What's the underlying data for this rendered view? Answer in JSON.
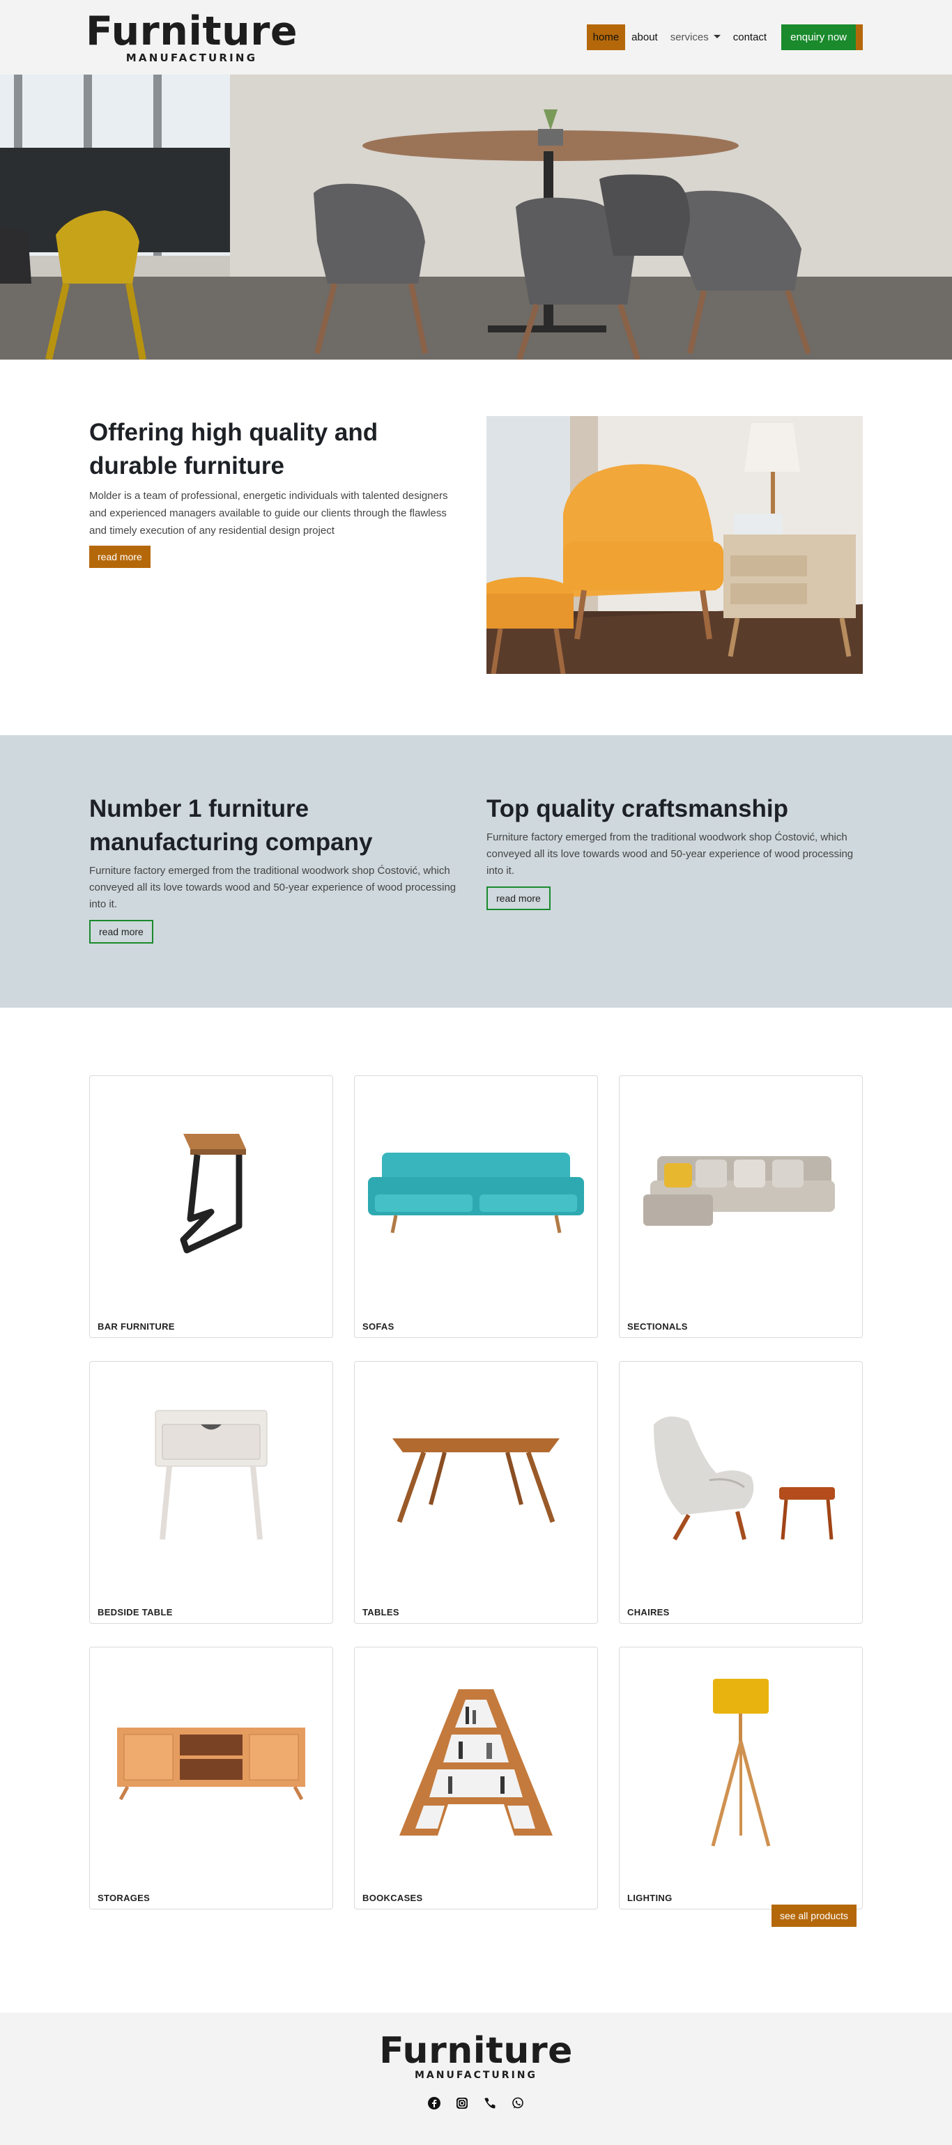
{
  "brand": {
    "name": "Furniture",
    "tagline": "MANUFACTURING"
  },
  "nav": {
    "home": "home",
    "about": "about",
    "services": "services",
    "contact": "contact",
    "enquiry": "enquiry now"
  },
  "about": {
    "title": "Offering high quality and durable furniture",
    "description": "Molder is a team of professional, energetic individuals with talented designers and experienced managers available to guide our clients through the flawless and timely execution of any residential design project",
    "button": "read more"
  },
  "features": [
    {
      "title": "Number 1 furniture manufacturing company",
      "description": "Furniture factory emerged from the traditional woodwork shop Ćostović, which conveyed all its love towards wood and 50-year experience of wood processing into it.",
      "button": "read more"
    },
    {
      "title": "Top quality craftsmanship",
      "description": "Furniture factory emerged from the traditional woodwork shop Ćostović, which conveyed all its love towards wood and 50-year experience of wood processing into it.",
      "button": "read more"
    }
  ],
  "products": [
    {
      "label": "BAR FURNITURE"
    },
    {
      "label": "SOFAS"
    },
    {
      "label": "SECTIONALS"
    },
    {
      "label": "BEDSIDE TABLE"
    },
    {
      "label": "TABLES"
    },
    {
      "label": "CHAIRES"
    },
    {
      "label": "STORAGES"
    },
    {
      "label": "BOOKCASES"
    },
    {
      "label": "LIGHTING"
    }
  ],
  "see_all": "see all products",
  "footer": {
    "name": "Furniture",
    "tagline": "MANUFACTURING"
  },
  "social_icons": [
    "facebook-icon",
    "instagram-icon",
    "phone-icon",
    "whatsapp-icon"
  ],
  "colors": {
    "accent": "#b5680a",
    "green": "#1a8a2c",
    "band": "#cfd8dd"
  }
}
